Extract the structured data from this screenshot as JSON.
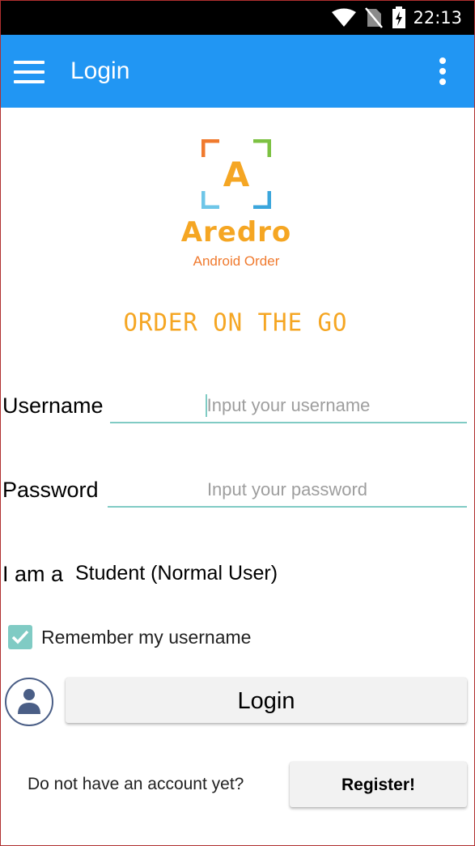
{
  "status_bar": {
    "time": "22:13",
    "icons": [
      "wifi-icon",
      "no-sim-icon",
      "battery-charging-icon"
    ]
  },
  "app_bar": {
    "title": "Login",
    "color": "#2196f3",
    "menu_icon": "hamburger-menu-icon",
    "overflow_icon": "more-vert-icon"
  },
  "logo": {
    "letter": "A",
    "name": "Aredro",
    "subtitle": "Android Order",
    "tagline": "ORDER ON THE GO"
  },
  "form": {
    "username": {
      "label": "Username",
      "value": "",
      "placeholder": "Input your username"
    },
    "password": {
      "label": "Password",
      "value": "",
      "placeholder": "Input your password"
    },
    "role": {
      "label": "I am a",
      "selected": "Student (Normal User)"
    },
    "remember": {
      "label": "Remember my username",
      "checked": true
    }
  },
  "actions": {
    "login_label": "Login",
    "register_prompt": "Do not have an account yet?",
    "register_label": "Register!"
  },
  "colors": {
    "accent": "#80cbc4",
    "logo_orange": "#f5a623",
    "logo_subtitle": "#f07a2e"
  }
}
